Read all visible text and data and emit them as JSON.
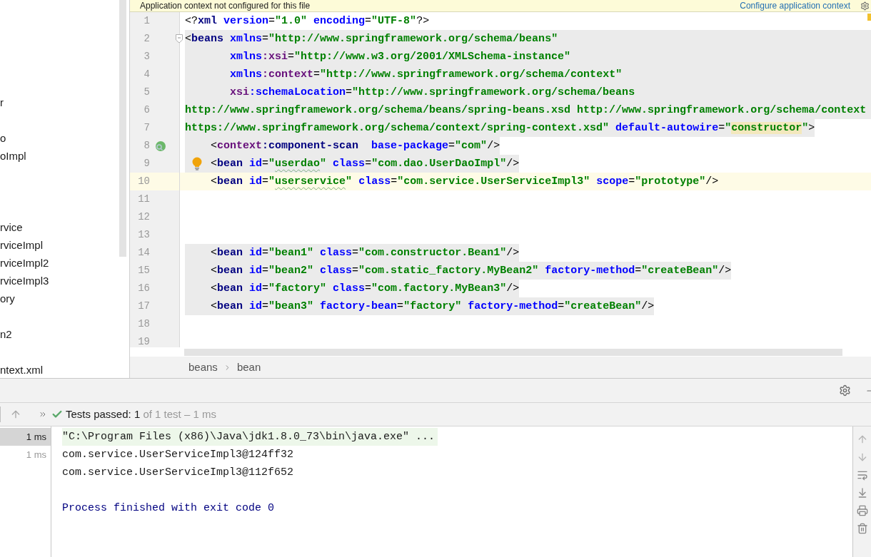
{
  "project_tree": {
    "items": [
      {
        "label": "r"
      },
      {
        "label": "o"
      },
      {
        "label": "oImpl"
      },
      {
        "label": "rvice"
      },
      {
        "label": "rviceImpl"
      },
      {
        "label": "rviceImpl2"
      },
      {
        "label": "rviceImpl3"
      },
      {
        "label": "ory"
      },
      {
        "label": "n2"
      },
      {
        "label": "ntext.xml"
      }
    ]
  },
  "notification": {
    "message": "Application context not configured for this file",
    "link": "Configure application context"
  },
  "editor": {
    "lines": [
      {
        "number": "1",
        "shaded": false,
        "current": false,
        "tokens": [
          {
            "kind": "punct",
            "text": "<?"
          },
          {
            "kind": "tag",
            "text": "xml"
          },
          {
            "kind": "attr",
            "text": " version"
          },
          {
            "kind": "punct",
            "text": "="
          },
          {
            "kind": "value",
            "text": "\"1.0\""
          },
          {
            "kind": "attr",
            "text": " encoding"
          },
          {
            "kind": "punct",
            "text": "="
          },
          {
            "kind": "value",
            "text": "\"UTF-8\""
          },
          {
            "kind": "punct",
            "text": "?>"
          }
        ]
      },
      {
        "number": "2",
        "shaded": true,
        "full_width": true,
        "current": false,
        "fold": true,
        "tokens": [
          {
            "kind": "punct",
            "text": "<"
          },
          {
            "kind": "tag",
            "text": "beans"
          },
          {
            "kind": "attr",
            "text": " xmlns"
          },
          {
            "kind": "punct",
            "text": "="
          },
          {
            "kind": "value",
            "text": "\"http://www.springframework.org/schema/beans\""
          }
        ]
      },
      {
        "number": "3",
        "shaded": true,
        "full_width": true,
        "current": false,
        "tokens": [
          {
            "kind": "attr",
            "text": "       xmlns"
          },
          {
            "kind": "ns",
            "text": ":xsi"
          },
          {
            "kind": "punct",
            "text": "="
          },
          {
            "kind": "value",
            "text": "\"http://www.w3.org/2001/XMLSchema-instance\""
          }
        ]
      },
      {
        "number": "4",
        "shaded": true,
        "full_width": true,
        "current": false,
        "tokens": [
          {
            "kind": "attr",
            "text": "       xmlns"
          },
          {
            "kind": "ns",
            "text": ":context"
          },
          {
            "kind": "punct",
            "text": "="
          },
          {
            "kind": "value",
            "text": "\"http://www.springframework.org/schema/context\""
          }
        ]
      },
      {
        "number": "5",
        "shaded": true,
        "full_width": true,
        "current": false,
        "tokens": [
          {
            "kind": "ns",
            "text": "       xsi"
          },
          {
            "kind": "attr",
            "text": ":schemaLocation"
          },
          {
            "kind": "punct",
            "text": "="
          },
          {
            "kind": "value",
            "text": "\"http://www.springframework.org/schema/beans"
          }
        ]
      },
      {
        "number": "6",
        "shaded": true,
        "full_width": true,
        "current": false,
        "tokens": [
          {
            "kind": "value",
            "text": "http://www.springframework.org/schema/beans/spring-beans.xsd http://www.springframework.org/schema/context"
          }
        ]
      },
      {
        "number": "7",
        "shaded": true,
        "current": false,
        "tokens": [
          {
            "kind": "value",
            "text": "https://www.springframework.org/schema/context/spring-context.xsd\""
          },
          {
            "kind": "attr",
            "text": " default-autowire"
          },
          {
            "kind": "punct",
            "text": "="
          },
          {
            "kind": "value",
            "text": "\""
          },
          {
            "kind": "value",
            "text": "constructor",
            "match": true
          },
          {
            "kind": "value",
            "text": "\""
          },
          {
            "kind": "punct",
            "text": ">"
          }
        ]
      },
      {
        "number": "8",
        "shaded": true,
        "current": false,
        "bean_icon": true,
        "tokens": [
          {
            "kind": "punct",
            "text": "    <"
          },
          {
            "kind": "ns",
            "text": "context"
          },
          {
            "kind": "tag",
            "text": ":component-scan"
          },
          {
            "kind": "attr",
            "text": "  base-package"
          },
          {
            "kind": "punct",
            "text": "="
          },
          {
            "kind": "value",
            "text": "\"com\""
          },
          {
            "kind": "punct",
            "text": "/>"
          }
        ]
      },
      {
        "number": "9",
        "shaded": true,
        "current": false,
        "bulb": true,
        "tokens": [
          {
            "kind": "punct",
            "text": "    <"
          },
          {
            "kind": "tag",
            "text": "bean"
          },
          {
            "kind": "attr",
            "text": " id"
          },
          {
            "kind": "punct",
            "text": "="
          },
          {
            "kind": "value",
            "text": "\""
          },
          {
            "kind": "value",
            "text": "userdao",
            "typo": true
          },
          {
            "kind": "value",
            "text": "\""
          },
          {
            "kind": "attr",
            "text": " class"
          },
          {
            "kind": "punct",
            "text": "="
          },
          {
            "kind": "value",
            "text": "\"com.dao.UserDaoImpl\""
          },
          {
            "kind": "punct",
            "text": "/>"
          }
        ]
      },
      {
        "number": "10",
        "shaded": false,
        "current": true,
        "tokens": [
          {
            "kind": "punct",
            "text": "    <"
          },
          {
            "kind": "tag",
            "text": "bean"
          },
          {
            "kind": "attr",
            "text": " id"
          },
          {
            "kind": "punct",
            "text": "="
          },
          {
            "kind": "value",
            "text": "\""
          },
          {
            "kind": "value",
            "text": "userservice",
            "typo": true
          },
          {
            "kind": "value",
            "text": "\""
          },
          {
            "kind": "attr",
            "text": " class"
          },
          {
            "kind": "punct",
            "text": "="
          },
          {
            "kind": "value",
            "text": "\"com.service.UserServiceImpl3\""
          },
          {
            "kind": "attr",
            "text": " scope"
          },
          {
            "kind": "punct",
            "text": "="
          },
          {
            "kind": "value",
            "text": "\"prototype\""
          },
          {
            "kind": "punct",
            "text": "/>"
          }
        ]
      },
      {
        "number": "11",
        "current": false
      },
      {
        "number": "12",
        "current": false
      },
      {
        "number": "13",
        "current": false
      },
      {
        "number": "14",
        "shaded": true,
        "current": false,
        "tokens": [
          {
            "kind": "punct",
            "text": "    <"
          },
          {
            "kind": "tag",
            "text": "bean"
          },
          {
            "kind": "attr",
            "text": " id"
          },
          {
            "kind": "punct",
            "text": "="
          },
          {
            "kind": "value",
            "text": "\"bean1\""
          },
          {
            "kind": "attr",
            "text": " class"
          },
          {
            "kind": "punct",
            "text": "="
          },
          {
            "kind": "value",
            "text": "\"com.constructor.Bean1\""
          },
          {
            "kind": "punct",
            "text": "/>"
          }
        ]
      },
      {
        "number": "15",
        "shaded": true,
        "current": false,
        "tokens": [
          {
            "kind": "punct",
            "text": "    <"
          },
          {
            "kind": "tag",
            "text": "bean"
          },
          {
            "kind": "attr",
            "text": " id"
          },
          {
            "kind": "punct",
            "text": "="
          },
          {
            "kind": "value",
            "text": "\"bean2\""
          },
          {
            "kind": "attr",
            "text": " class"
          },
          {
            "kind": "punct",
            "text": "="
          },
          {
            "kind": "value",
            "text": "\"com.static_factory.MyBean2\""
          },
          {
            "kind": "attr",
            "text": " factory-method"
          },
          {
            "kind": "punct",
            "text": "="
          },
          {
            "kind": "value",
            "text": "\"createBean\""
          },
          {
            "kind": "punct",
            "text": "/>"
          }
        ]
      },
      {
        "number": "16",
        "shaded": true,
        "current": false,
        "tokens": [
          {
            "kind": "punct",
            "text": "    <"
          },
          {
            "kind": "tag",
            "text": "bean"
          },
          {
            "kind": "attr",
            "text": " id"
          },
          {
            "kind": "punct",
            "text": "="
          },
          {
            "kind": "value",
            "text": "\"factory\""
          },
          {
            "kind": "attr",
            "text": " class"
          },
          {
            "kind": "punct",
            "text": "="
          },
          {
            "kind": "value",
            "text": "\"com.factory.MyBean3\""
          },
          {
            "kind": "punct",
            "text": "/>"
          }
        ]
      },
      {
        "number": "17",
        "shaded": true,
        "current": false,
        "tokens": [
          {
            "kind": "punct",
            "text": "    <"
          },
          {
            "kind": "tag",
            "text": "bean"
          },
          {
            "kind": "attr",
            "text": " id"
          },
          {
            "kind": "punct",
            "text": "="
          },
          {
            "kind": "value",
            "text": "\"bean3\""
          },
          {
            "kind": "attr",
            "text": " factory-bean"
          },
          {
            "kind": "punct",
            "text": "="
          },
          {
            "kind": "value",
            "text": "\"factory\""
          },
          {
            "kind": "attr",
            "text": " factory-method"
          },
          {
            "kind": "punct",
            "text": "="
          },
          {
            "kind": "value",
            "text": "\"createBean\""
          },
          {
            "kind": "punct",
            "text": "/>"
          }
        ]
      },
      {
        "number": "18",
        "current": false
      },
      {
        "number": "19",
        "current": false
      }
    ],
    "breadcrumbs": [
      "beans",
      "bean"
    ]
  },
  "run_panel": {
    "status": {
      "label": "Tests passed:",
      "passed": "1",
      "detail": "of 1 test – 1 ms"
    },
    "tests": [
      {
        "time": "1 ms",
        "selected": true
      },
      {
        "time": "1 ms",
        "selected": false
      }
    ],
    "console": [
      {
        "kind": "command",
        "text": "\"C:\\Program Files (x86)\\Java\\jdk1.8.0_73\\bin\\java.exe\" ..."
      },
      {
        "kind": "output",
        "text": "com.service.UserServiceImpl3@124ff32"
      },
      {
        "kind": "output",
        "text": "com.service.UserServiceImpl3@112f652"
      },
      {
        "kind": "exit",
        "text": "Process finished with exit code 0"
      }
    ]
  }
}
